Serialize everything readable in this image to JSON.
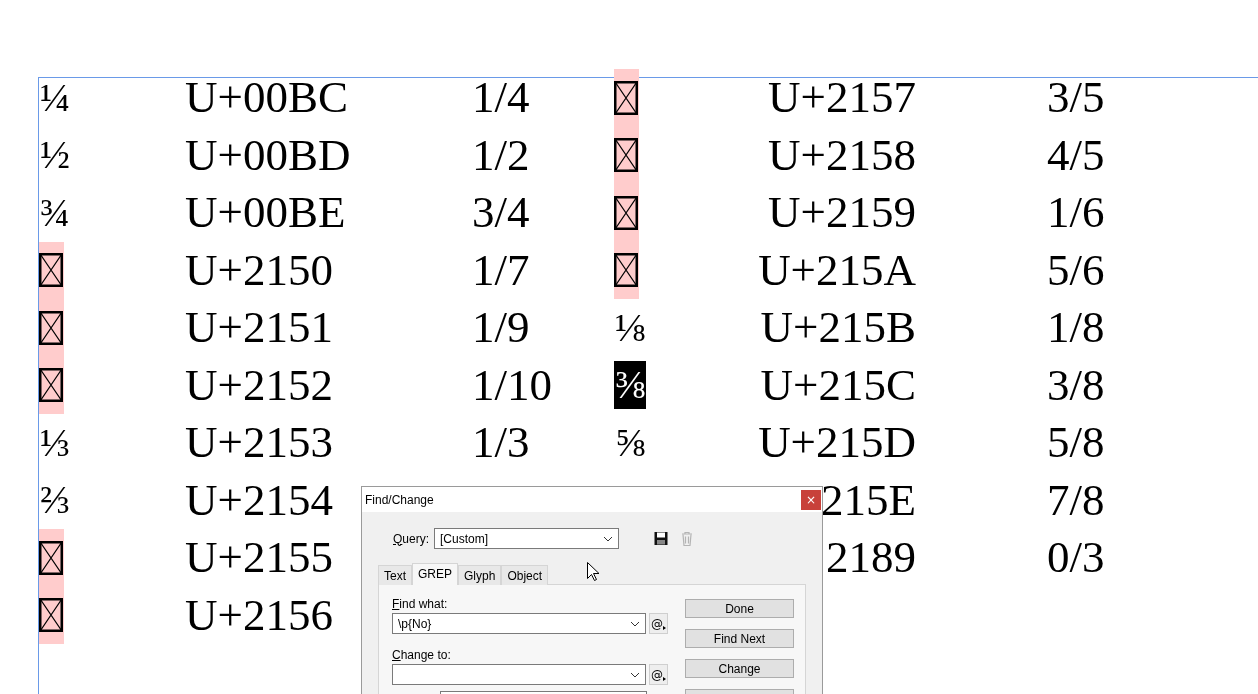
{
  "table": {
    "rows": [
      {
        "left": {
          "glyph": {
            "kind": "char",
            "text": "¼",
            "selected": false
          },
          "code": "U+00BC",
          "fraction": "1/4"
        },
        "right": {
          "glyph": {
            "kind": "missing"
          },
          "code": "U+2157",
          "fraction": "3/5"
        }
      },
      {
        "left": {
          "glyph": {
            "kind": "char",
            "text": "½",
            "selected": false
          },
          "code": "U+00BD",
          "fraction": "1/2"
        },
        "right": {
          "glyph": {
            "kind": "missing"
          },
          "code": "U+2158",
          "fraction": "4/5"
        }
      },
      {
        "left": {
          "glyph": {
            "kind": "char",
            "text": "¾",
            "selected": false
          },
          "code": "U+00BE",
          "fraction": "3/4"
        },
        "right": {
          "glyph": {
            "kind": "missing"
          },
          "code": "U+2159",
          "fraction": "1/6"
        }
      },
      {
        "left": {
          "glyph": {
            "kind": "missing"
          },
          "code": "U+2150",
          "fraction": "1/7"
        },
        "right": {
          "glyph": {
            "kind": "missing"
          },
          "code": "U+215A",
          "fraction": "5/6"
        }
      },
      {
        "left": {
          "glyph": {
            "kind": "missing"
          },
          "code": "U+2151",
          "fraction": "1/9"
        },
        "right": {
          "glyph": {
            "kind": "char",
            "text": "⅛",
            "selected": false
          },
          "code": "U+215B",
          "fraction": "1/8"
        }
      },
      {
        "left": {
          "glyph": {
            "kind": "missing"
          },
          "code": "U+2152",
          "fraction": "1/10"
        },
        "right": {
          "glyph": {
            "kind": "char",
            "text": "⅜",
            "selected": true
          },
          "code": "U+215C",
          "fraction": "3/8"
        }
      },
      {
        "left": {
          "glyph": {
            "kind": "char",
            "text": "⅓",
            "selected": false
          },
          "code": "U+2153",
          "fraction": "1/3"
        },
        "right": {
          "glyph": {
            "kind": "char",
            "text": "⅝",
            "selected": false
          },
          "code": "U+215D",
          "fraction": "5/8"
        }
      },
      {
        "left": {
          "glyph": {
            "kind": "char",
            "text": "⅔",
            "selected": false
          },
          "code": "U+2154"
        },
        "right": {
          "code": "215E",
          "fraction": "7/8"
        }
      },
      {
        "left": {
          "glyph": {
            "kind": "missing"
          },
          "code": "U+2155"
        },
        "right": {
          "code": "2189",
          "fraction": "0/3"
        }
      },
      {
        "left": {
          "glyph": {
            "kind": "missing"
          },
          "code": "U+2156"
        },
        "right": {}
      }
    ]
  },
  "dialog": {
    "title": "Find/Change",
    "close": "×",
    "query_label": "Query:",
    "query_value": "[Custom]",
    "tabs": [
      {
        "label": "Text",
        "selected": false
      },
      {
        "label": "GREP",
        "selected": true
      },
      {
        "label": "Glyph",
        "selected": false
      },
      {
        "label": "Object",
        "selected": false
      }
    ],
    "find_label": "Find what:",
    "find_value": "\\p{No}",
    "find_special": "@",
    "change_label": "Change to:",
    "change_special": "@",
    "buttons": [
      "Done",
      "Find Next",
      "Change"
    ]
  }
}
